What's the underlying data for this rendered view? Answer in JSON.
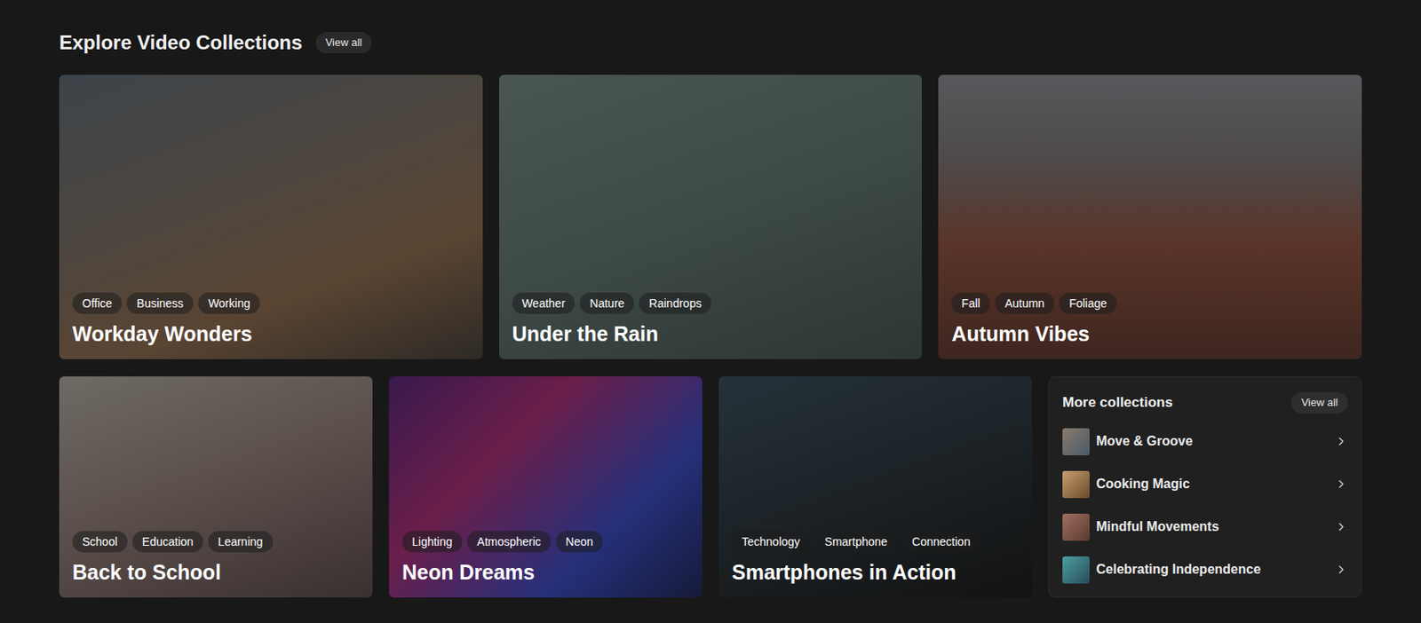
{
  "section": {
    "title": "Explore Video Collections",
    "view_all": "View all"
  },
  "collections": [
    {
      "title": "Workday Wonders",
      "tags": [
        "Office",
        "Business",
        "Working"
      ]
    },
    {
      "title": "Under the Rain",
      "tags": [
        "Weather",
        "Nature",
        "Raindrops"
      ]
    },
    {
      "title": "Autumn Vibes",
      "tags": [
        "Fall",
        "Autumn",
        "Foliage"
      ]
    },
    {
      "title": "Back to School",
      "tags": [
        "School",
        "Education",
        "Learning"
      ]
    },
    {
      "title": "Neon Dreams",
      "tags": [
        "Lighting",
        "Atmospheric",
        "Neon"
      ]
    },
    {
      "title": "Smartphones in Action",
      "tags": [
        "Technology",
        "Smartphone",
        "Connection"
      ]
    }
  ],
  "more_collections": {
    "title": "More collections",
    "view_all": "View all",
    "items": [
      {
        "title": "Move & Groove"
      },
      {
        "title": "Cooking Magic"
      },
      {
        "title": "Mindful Movements"
      },
      {
        "title": "Celebrating Independence"
      }
    ]
  }
}
